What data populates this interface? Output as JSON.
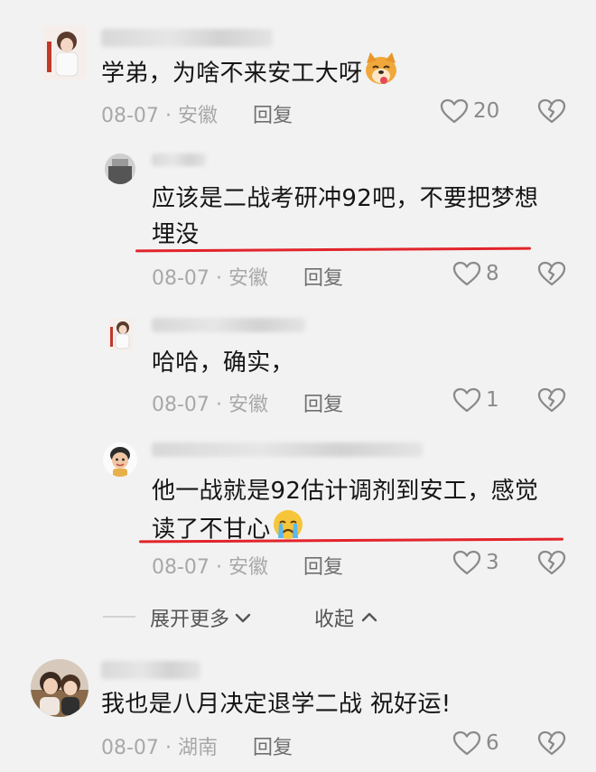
{
  "comments": [
    {
      "text": "学弟，为啥不来安工大呀",
      "date": "08-07",
      "location": "安徽",
      "reply": "回复",
      "likes": "20"
    },
    {
      "text_line1": "应该是二战考研冲92吧，不要把梦想",
      "text_line2": "埋没",
      "date": "08-07",
      "location": "安徽",
      "reply": "回复",
      "likes": "8"
    },
    {
      "text": "哈哈，确实，",
      "date": "08-07",
      "location": "安徽",
      "reply": "回复",
      "likes": "1"
    },
    {
      "text_line1": "他一战就是92估计调剂到安工，感觉",
      "text_line2": "读了不甘心",
      "date": "08-07",
      "location": "安徽",
      "reply": "回复",
      "likes": "3"
    },
    {
      "text": "我也是八月决定退学二战 祝好运!",
      "date": "08-07",
      "location": "湖南",
      "reply": "回复",
      "likes": "6"
    }
  ],
  "thread_controls": {
    "expand_label": "展开更多",
    "collapse_label": "收起"
  },
  "separator": "·",
  "colors": {
    "highlight_line": "#e2242b",
    "meta_text": "#a8a8a8",
    "background": "#f2f2f2"
  }
}
